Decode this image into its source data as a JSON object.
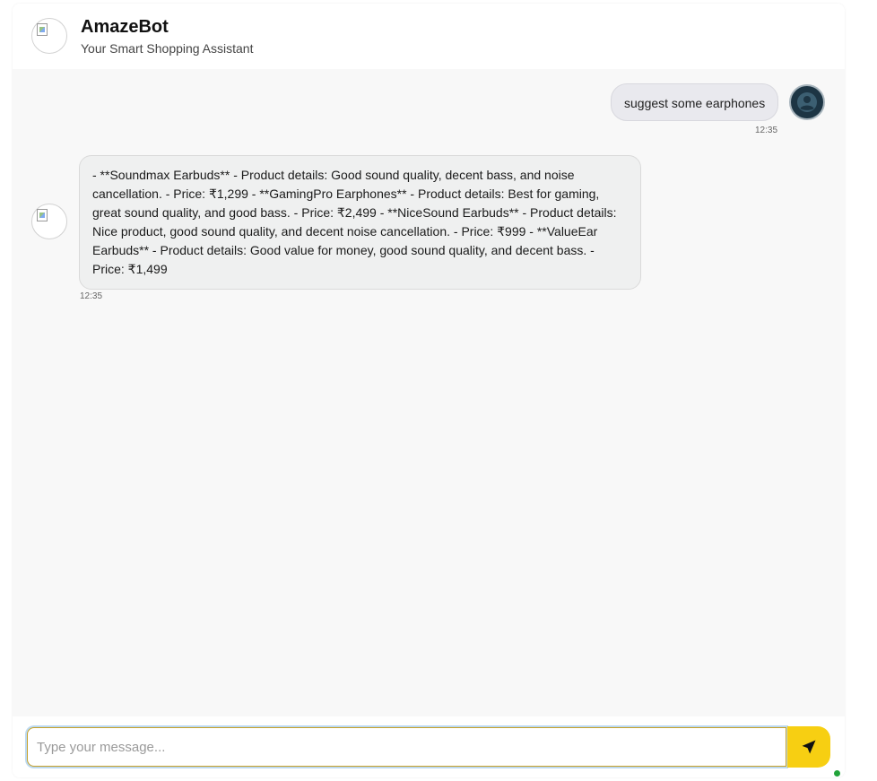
{
  "header": {
    "title": "AmazeBot",
    "subtitle": "Your Smart Shopping Assistant",
    "avatar_icon": "broken-image-icon"
  },
  "messages": [
    {
      "sender": "user",
      "text": "suggest some earphones",
      "time": "12:35",
      "avatar_icon": "user-avatar-icon"
    },
    {
      "sender": "bot",
      "text": "- **Soundmax Earbuds** - Product details: Good sound quality, decent bass, and noise cancellation. - Price: ₹1,299 - **GamingPro Earphones** - Product details: Best for gaming, great sound quality, and good bass. - Price: ₹2,499 - **NiceSound Earbuds** - Product details: Nice product, good sound quality, and decent noise cancellation. - Price: ₹999 - **ValueEar Earbuds** - Product details: Good value for money, good sound quality, and decent bass. - Price: ₹1,499",
      "time": "12:35",
      "avatar_icon": "broken-image-icon"
    }
  ],
  "composer": {
    "placeholder": "Type your message...",
    "value": "",
    "send_icon": "send-arrow-icon"
  },
  "colors": {
    "accent": "#f7cf12",
    "user_avatar_bg": "#1d3544",
    "status_online": "#21a33a",
    "background": "#f8f8f8"
  }
}
